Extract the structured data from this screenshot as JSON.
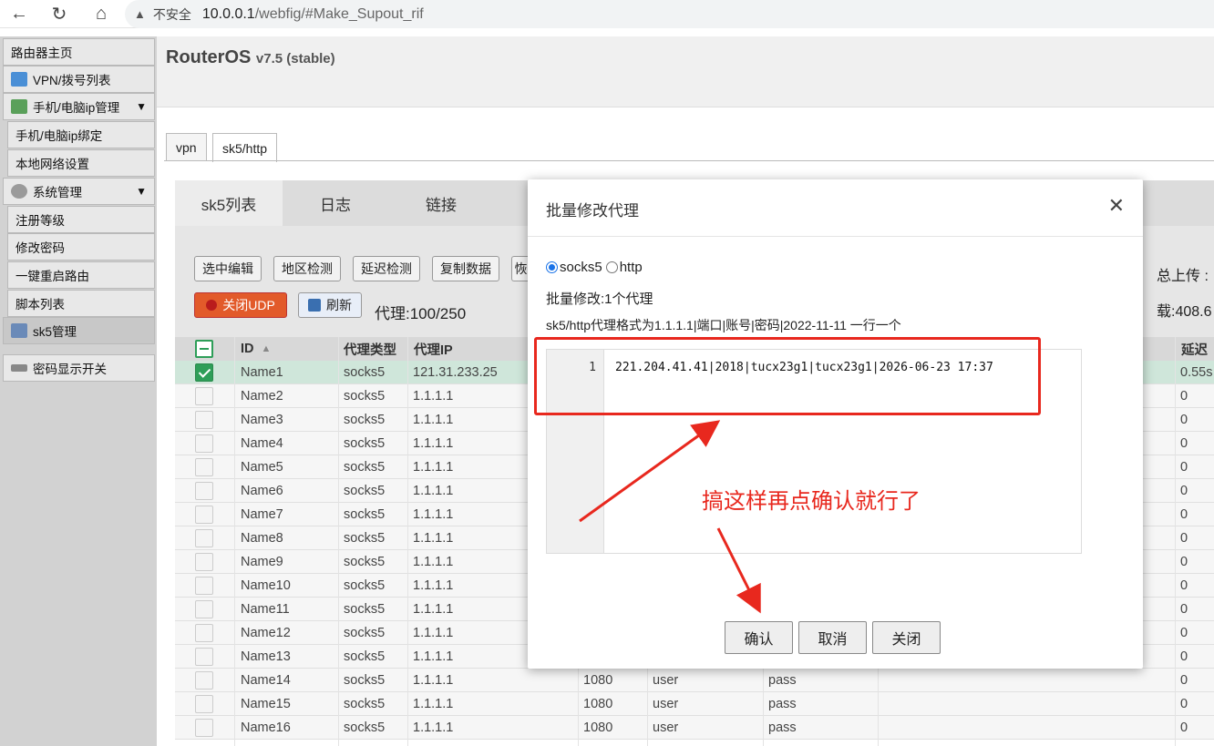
{
  "browser": {
    "back_icon": "back-arrow-icon",
    "reload_icon": "reload-icon",
    "home_icon": "home-icon",
    "insecure_label": "不安全",
    "url_host": "10.0.0.1",
    "url_path": "/webfig/#Make_Supout_rif"
  },
  "sidebar": {
    "items": [
      {
        "label": "路由器主页"
      },
      {
        "label": "VPN/拨号列表"
      },
      {
        "label": "手机/电脑ip管理"
      },
      {
        "label": "手机/电脑ip绑定"
      },
      {
        "label": "本地网络设置"
      },
      {
        "label": "系统管理"
      },
      {
        "label": "注册等级"
      },
      {
        "label": "修改密码"
      },
      {
        "label": "一键重启路由"
      },
      {
        "label": "脚本列表"
      },
      {
        "label": "sk5管理"
      },
      {
        "label": "密码显示开关"
      }
    ]
  },
  "header": {
    "brand": "RouterOS",
    "version": "v7.5 (stable)"
  },
  "tabs": [
    {
      "label": "vpn"
    },
    {
      "label": "sk5/http"
    }
  ],
  "subtabs": [
    {
      "label": "sk5列表"
    },
    {
      "label": "日志"
    },
    {
      "label": "链接"
    }
  ],
  "toolbar": {
    "buttons": [
      "选中编辑",
      "地区检测",
      "延迟检测",
      "复制数据",
      "恢"
    ],
    "udp_label": "关闭UDP",
    "refresh_label": "刷新",
    "proxy_count": "代理:100/250",
    "upload_label": "总上传 :",
    "load_label": "载:408.6"
  },
  "table": {
    "headers": {
      "id": "ID",
      "type": "代理类型",
      "ip": "代理IP",
      "delay": "延迟"
    },
    "rows": [
      {
        "name": "Name1",
        "type": "socks5",
        "ip": "121.31.233.25",
        "port": "",
        "user": "",
        "pass": "",
        "delay": "0.55s",
        "checked": true
      },
      {
        "name": "Name2",
        "type": "socks5",
        "ip": "1.1.1.1",
        "port": "",
        "user": "",
        "pass": "",
        "delay": "0",
        "checked": false
      },
      {
        "name": "Name3",
        "type": "socks5",
        "ip": "1.1.1.1",
        "port": "",
        "user": "",
        "pass": "",
        "delay": "0",
        "checked": false
      },
      {
        "name": "Name4",
        "type": "socks5",
        "ip": "1.1.1.1",
        "port": "",
        "user": "",
        "pass": "",
        "delay": "0",
        "checked": false
      },
      {
        "name": "Name5",
        "type": "socks5",
        "ip": "1.1.1.1",
        "port": "",
        "user": "",
        "pass": "",
        "delay": "0",
        "checked": false
      },
      {
        "name": "Name6",
        "type": "socks5",
        "ip": "1.1.1.1",
        "port": "",
        "user": "",
        "pass": "",
        "delay": "0",
        "checked": false
      },
      {
        "name": "Name7",
        "type": "socks5",
        "ip": "1.1.1.1",
        "port": "",
        "user": "",
        "pass": "",
        "delay": "0",
        "checked": false
      },
      {
        "name": "Name8",
        "type": "socks5",
        "ip": "1.1.1.1",
        "port": "",
        "user": "",
        "pass": "",
        "delay": "0",
        "checked": false
      },
      {
        "name": "Name9",
        "type": "socks5",
        "ip": "1.1.1.1",
        "port": "",
        "user": "",
        "pass": "",
        "delay": "0",
        "checked": false
      },
      {
        "name": "Name10",
        "type": "socks5",
        "ip": "1.1.1.1",
        "port": "",
        "user": "",
        "pass": "",
        "delay": "0",
        "checked": false
      },
      {
        "name": "Name11",
        "type": "socks5",
        "ip": "1.1.1.1",
        "port": "",
        "user": "",
        "pass": "",
        "delay": "0",
        "checked": false
      },
      {
        "name": "Name12",
        "type": "socks5",
        "ip": "1.1.1.1",
        "port": "",
        "user": "",
        "pass": "",
        "delay": "0",
        "checked": false
      },
      {
        "name": "Name13",
        "type": "socks5",
        "ip": "1.1.1.1",
        "port": "",
        "user": "",
        "pass": "",
        "delay": "0",
        "checked": false
      },
      {
        "name": "Name14",
        "type": "socks5",
        "ip": "1.1.1.1",
        "port": "1080",
        "user": "user",
        "pass": "pass",
        "delay": "0",
        "checked": false
      },
      {
        "name": "Name15",
        "type": "socks5",
        "ip": "1.1.1.1",
        "port": "1080",
        "user": "user",
        "pass": "pass",
        "delay": "0",
        "checked": false
      },
      {
        "name": "Name16",
        "type": "socks5",
        "ip": "1.1.1.1",
        "port": "1080",
        "user": "user",
        "pass": "pass",
        "delay": "0",
        "checked": false
      }
    ]
  },
  "modal": {
    "title": "批量修改代理",
    "radio_socks5": "socks5",
    "radio_http": "http",
    "edit_count": "批量修改:1个代理",
    "format_hint": "sk5/http代理格式为1.1.1.1|端口|账号|密码|2022-11-11 一行一个",
    "line_number": "1",
    "editor_line": "221.204.41.41|2018|tucx23g1|tucx23g1|2026-06-23 17:37",
    "confirm_label": "确认",
    "cancel_label": "取消",
    "close_label": "关闭"
  },
  "annotation": {
    "text": "搞这样再点确认就行了",
    "color": "#e8281e"
  },
  "colors": {
    "accent_green": "#2e9e58",
    "udp_red": "#e25a2a",
    "highlight_red": "#e8281e"
  }
}
